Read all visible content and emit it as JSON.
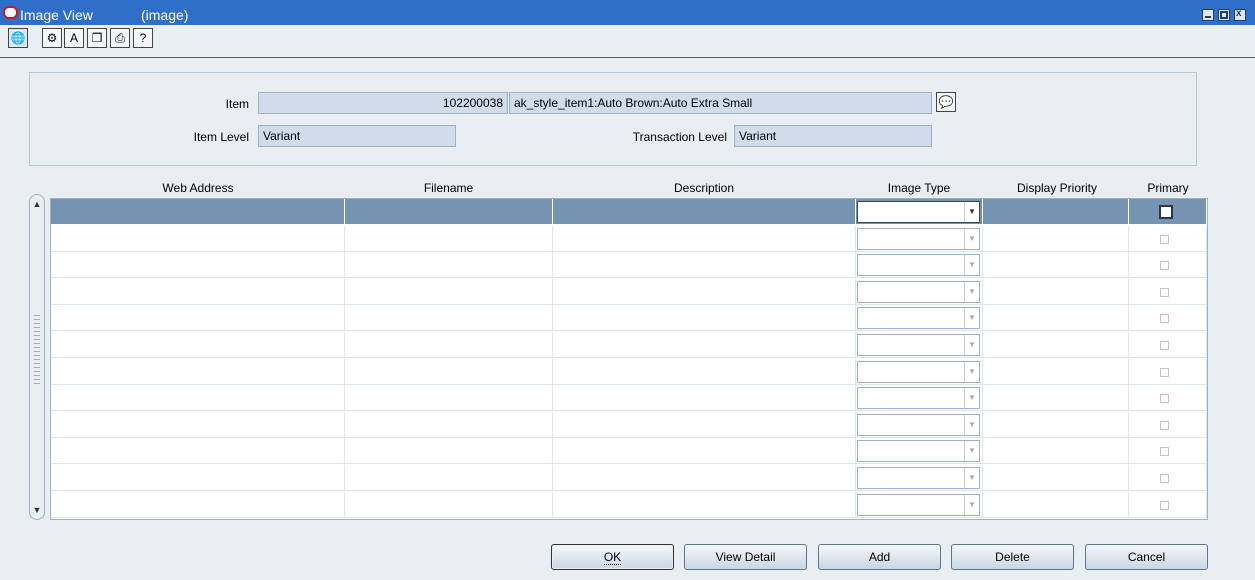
{
  "window": {
    "app_title": "Image View",
    "context": "(image)"
  },
  "toolbar": {
    "icons": [
      "globe-icon",
      "info-icon",
      "spell-check-icon",
      "copy-icon",
      "print-icon",
      "help-icon"
    ]
  },
  "header_panel": {
    "item_label": "Item",
    "item_number": "102200038",
    "item_description": "ak_style_item1:Auto Brown:Auto Extra Small",
    "item_level_label": "Item Level",
    "item_level_value": "Variant",
    "transaction_level_label": "Transaction Level",
    "transaction_level_value": "Variant"
  },
  "table": {
    "columns": [
      "Web Address",
      "Filename",
      "Description",
      "Image Type",
      "Display Priority",
      "Primary"
    ],
    "row_count": 12,
    "selected_row": 0
  },
  "buttons": {
    "ok": "OK",
    "view_detail": "View Detail",
    "add": "Add",
    "delete": "Delete",
    "cancel": "Cancel"
  },
  "colors": {
    "title_bar": "#2f6ec9",
    "selected_row": "#7594b1",
    "field_bg": "#d0dce9"
  }
}
